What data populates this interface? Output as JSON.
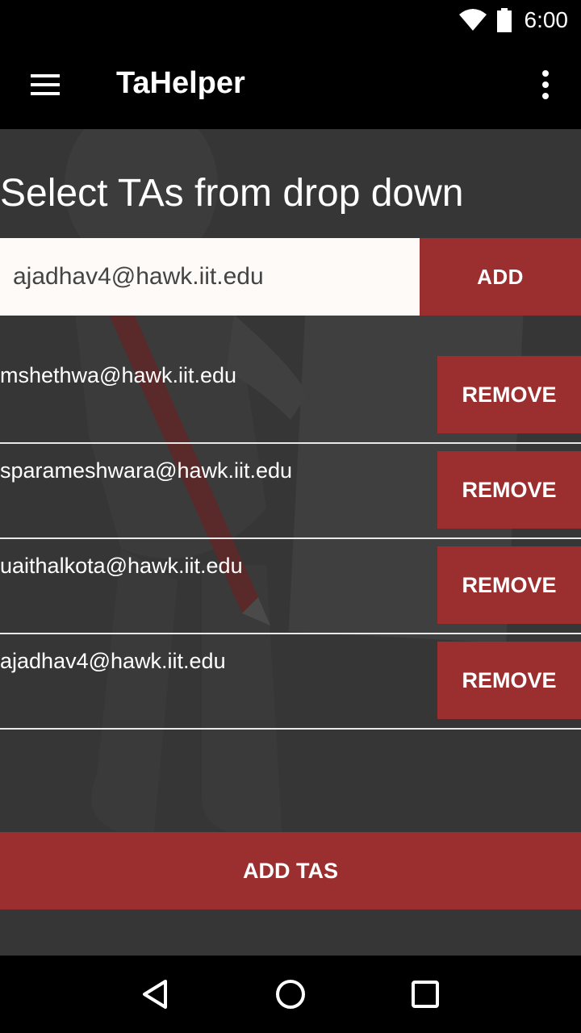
{
  "status_bar": {
    "time": "6:00",
    "icons": [
      "wifi-icon",
      "battery-icon"
    ]
  },
  "app_bar": {
    "title": "TaHelper",
    "menu_icon": "hamburger-menu-icon",
    "overflow_icon": "more-vert-icon"
  },
  "main": {
    "heading": "Select TAs from drop down",
    "selector": {
      "value": "ajadhav4@hawk.iit.edu",
      "add_label": "ADD"
    },
    "ta_list": [
      {
        "email": "mshethwa@hawk.iit.edu",
        "remove_label": "REMOVE"
      },
      {
        "email": "sparameshwara@hawk.iit.edu",
        "remove_label": "REMOVE"
      },
      {
        "email": "uaithalkota@hawk.iit.edu",
        "remove_label": "REMOVE"
      },
      {
        "email": "ajadhav4@hawk.iit.edu",
        "remove_label": "REMOVE"
      }
    ],
    "add_tas_label": "ADD TAS"
  },
  "nav_bar": {
    "buttons": [
      "back-icon",
      "home-icon",
      "recents-icon"
    ]
  },
  "colors": {
    "accent": "#9b2f30",
    "background": "#363636",
    "bar": "#000000"
  }
}
